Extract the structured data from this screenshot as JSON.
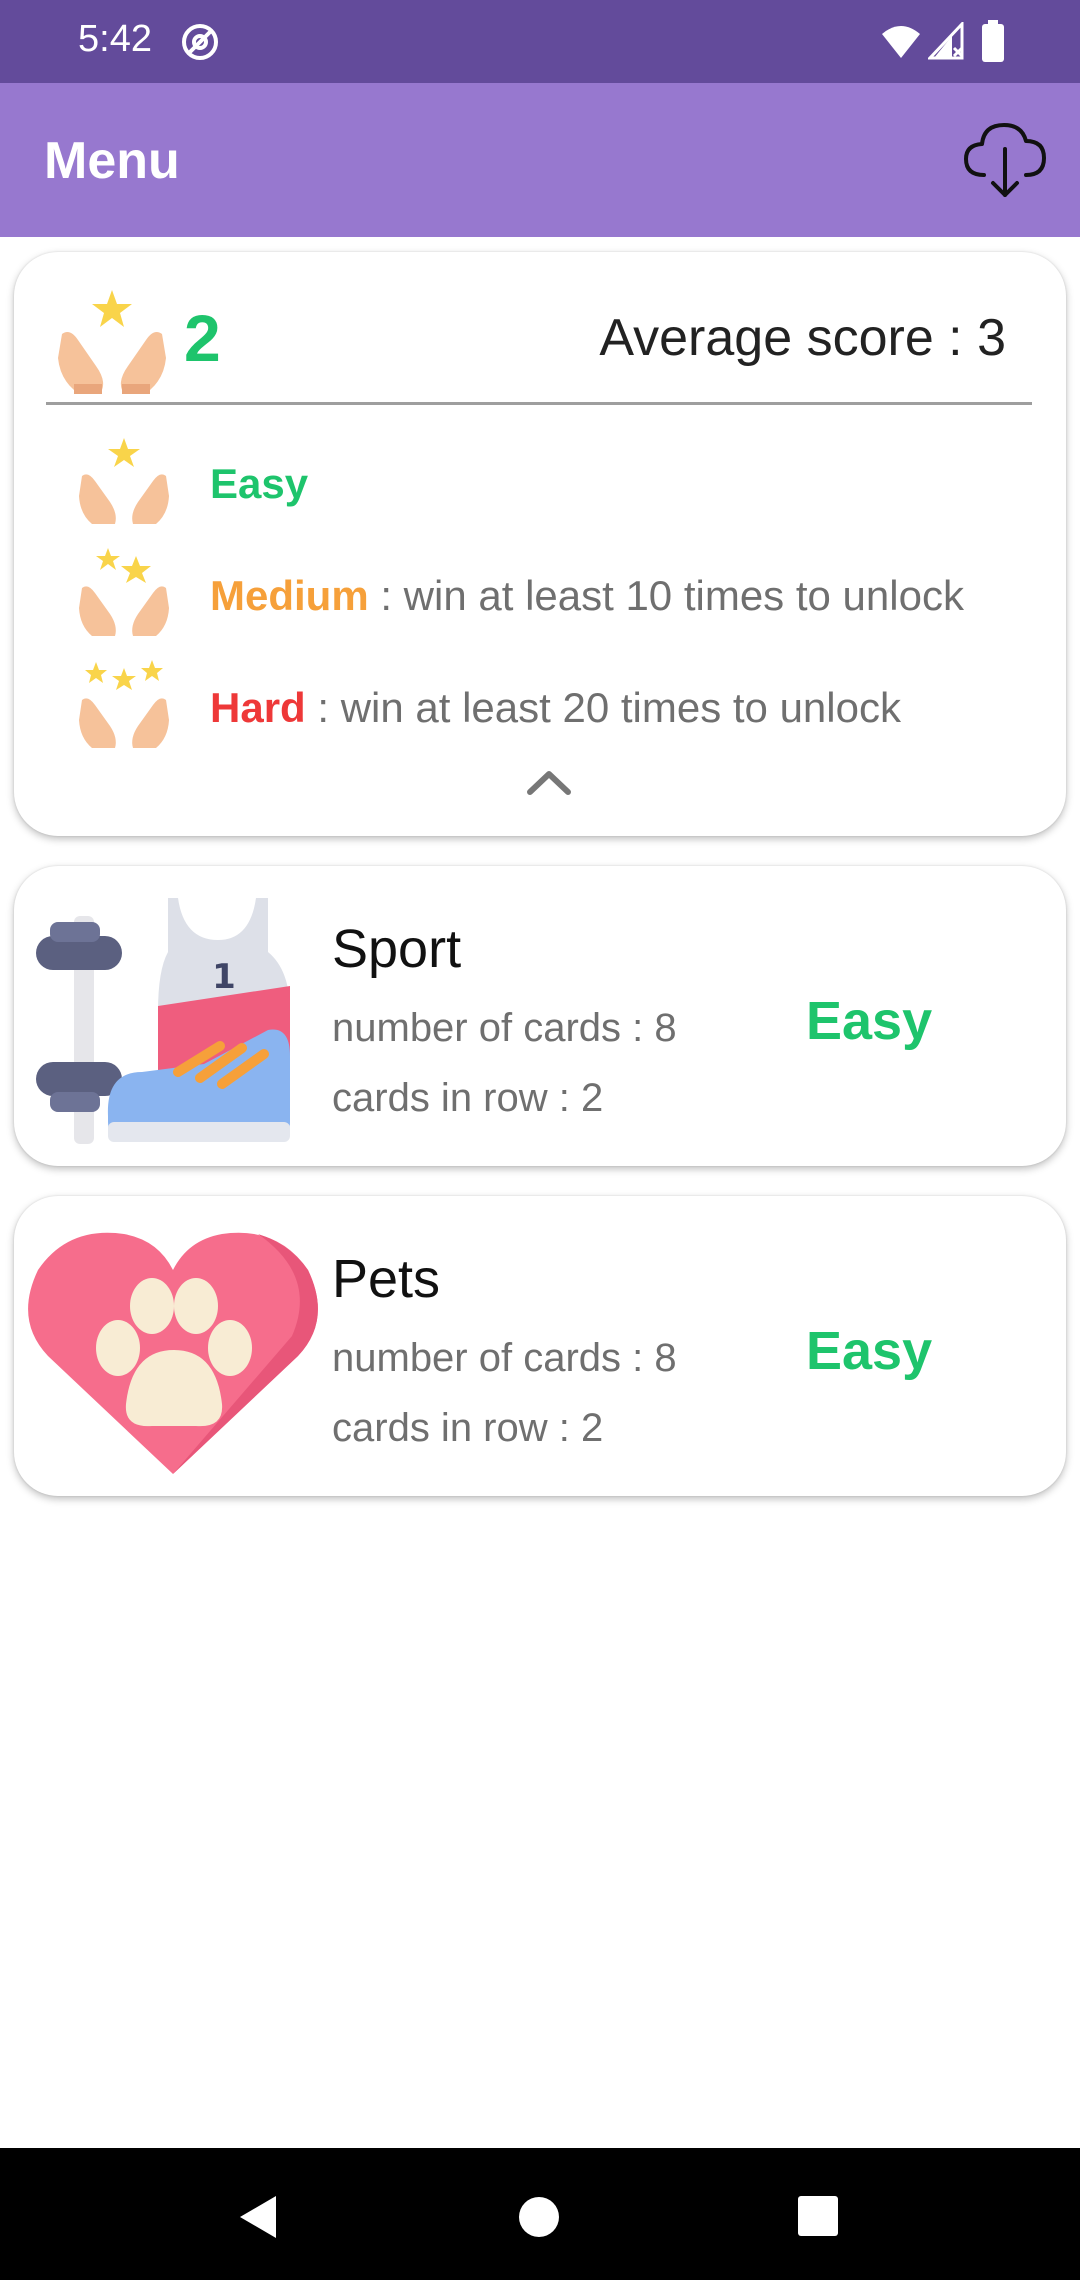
{
  "status_bar": {
    "time": "5:42",
    "icons": [
      "at-sign-icon",
      "wifi-icon",
      "signal-icon",
      "battery-icon"
    ]
  },
  "app_bar": {
    "title": "Menu",
    "action_icon": "cloud-download-icon"
  },
  "stats": {
    "wins": "2",
    "average_score": "Average score : 3",
    "levels": [
      {
        "name": "Easy",
        "suffix": "",
        "stars": 1,
        "color": "#1ec46c"
      },
      {
        "name": "Medium",
        "suffix": " : win at least 10 times to unlock",
        "stars": 2,
        "color": "#f6a03a"
      },
      {
        "name": "Hard",
        "suffix": " : win at least 20 times to unlock",
        "stars": 3,
        "color": "#ee3838"
      }
    ],
    "collapse_icon": "chevron-up-icon"
  },
  "categories": [
    {
      "title": "Sport",
      "cards_count": "number of cards : 8",
      "cards_in_row": "cards in row : 2",
      "difficulty": "Easy",
      "image_icon": "sport-icon"
    },
    {
      "title": "Pets",
      "cards_count": "number of cards : 8",
      "cards_in_row": "cards in row : 2",
      "difficulty": "Easy",
      "image_icon": "paw-heart-icon"
    }
  ],
  "colors": {
    "status_bar": "#634b9b",
    "app_bar": "#9778cf",
    "easy": "#1ec46c",
    "medium": "#f6a03a",
    "hard": "#ee3838"
  }
}
